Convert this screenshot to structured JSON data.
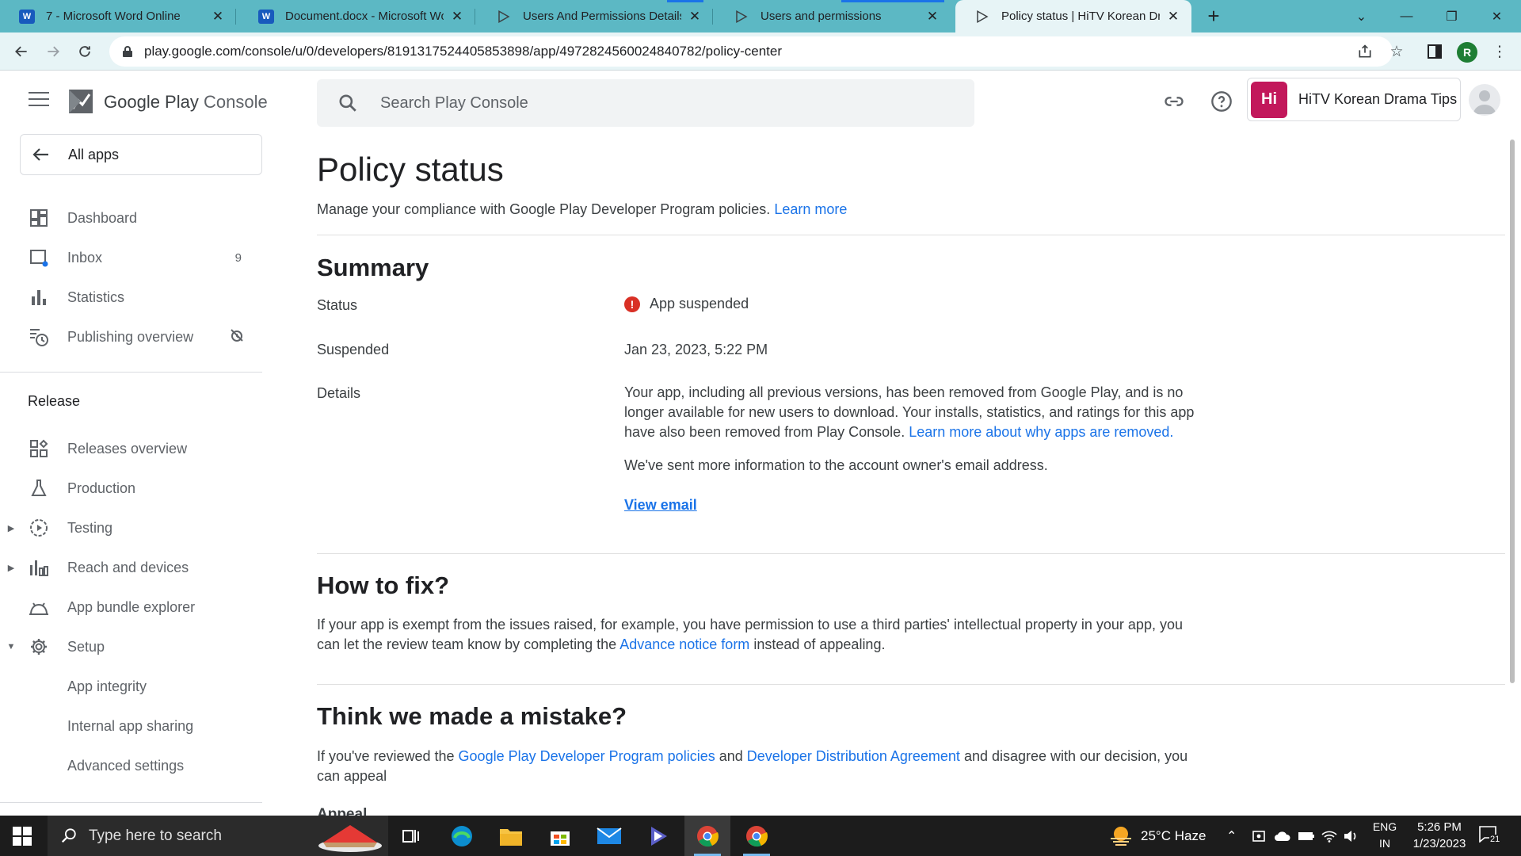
{
  "browser": {
    "tabs": [
      {
        "title": "7 - Microsoft Word Online",
        "icon": "word-icon"
      },
      {
        "title": "Document.docx - Microsoft Word",
        "icon": "word-icon"
      },
      {
        "title": "Users And Permissions Details",
        "icon": "play-console-icon"
      },
      {
        "title": "Users and permissions",
        "icon": "play-console-icon"
      },
      {
        "title": "Policy status | HiTV Korean Drama Tips",
        "icon": "play-console-icon",
        "active": true
      }
    ],
    "url": "play.google.com/console/u/0/developers/8191317524405853898/app/4972824560024840782/policy-center",
    "profile_initial": "R"
  },
  "header": {
    "brand_google": "Google Play",
    "brand_console": "Console",
    "search_placeholder": "Search Play Console",
    "app_icon_text": "Hi",
    "app_name": "HiTV Korean Drama Tips"
  },
  "sidebar": {
    "all_apps": "All apps",
    "items": [
      {
        "label": "Dashboard",
        "icon": "dashboard-icon"
      },
      {
        "label": "Inbox",
        "icon": "inbox-icon",
        "badge": "9"
      },
      {
        "label": "Statistics",
        "icon": "statistics-icon"
      },
      {
        "label": "Publishing overview",
        "icon": "publishing-overview-icon"
      }
    ],
    "release_section": "Release",
    "release_items": [
      {
        "label": "Releases overview",
        "icon": "releases-overview-icon"
      },
      {
        "label": "Production",
        "icon": "production-icon"
      },
      {
        "label": "Testing",
        "icon": "testing-icon"
      },
      {
        "label": "Reach and devices",
        "icon": "reach-devices-icon"
      },
      {
        "label": "App bundle explorer",
        "icon": "app-bundle-icon"
      },
      {
        "label": "Setup",
        "icon": "gear-icon"
      },
      {
        "label": "App integrity"
      },
      {
        "label": "Internal app sharing"
      },
      {
        "label": "Advanced settings"
      }
    ]
  },
  "page": {
    "title": "Policy status",
    "subtitle": "Manage your compliance with Google Play Developer Program policies.",
    "learn_more": "Learn more",
    "summary": {
      "heading": "Summary",
      "status_label": "Status",
      "status_value": "App suspended",
      "suspended_label": "Suspended",
      "suspended_value": "Jan 23, 2023, 5:22 PM",
      "details_label": "Details",
      "details_text": "Your app, including all previous versions, has been removed from Google Play, and is no longer available for new users to download. Your installs, statistics, and ratings for this app have also been removed from Play Console.",
      "details_link": "Learn more about why apps are removed.",
      "email_text": "We've sent more information to the account owner's email address.",
      "view_email": "View email"
    },
    "how_to_fix": {
      "heading": "How to fix?",
      "text_before": "If your app is exempt from the issues raised, for example, you have permission to use a third parties' intellectual property in your app, you can let the review team know by completing the",
      "link": "Advance notice form",
      "text_after": "instead of appealing."
    },
    "mistake": {
      "heading": "Think we made a mistake?",
      "text_1": "If you've reviewed the",
      "link_1": "Google Play Developer Program policies",
      "text_2": "and",
      "link_2": "Developer Distribution Agreement",
      "text_3": "and disagree with our decision, you can appeal",
      "cut_off": "Appeal"
    }
  },
  "taskbar": {
    "search_placeholder": "Type here to search",
    "weather": "25°C  Haze",
    "lang_top": "ENG",
    "lang_bottom": "IN",
    "time": "5:26 PM",
    "date": "1/23/2023",
    "notification_count": "21"
  },
  "colors": {
    "accent_link": "#1a73e8",
    "error": "#d93025",
    "tabstrip": "#5cb8c4",
    "toolbar": "#e7f4f6"
  }
}
